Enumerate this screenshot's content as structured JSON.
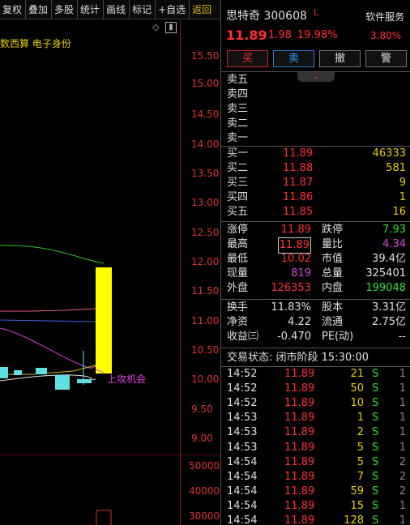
{
  "toolbar": {
    "items": [
      "复权",
      "叠加",
      "多股",
      "统计",
      "画线",
      "标记",
      "+自选",
      "返回"
    ]
  },
  "chart": {
    "indicator_label": "数西算 电子身份",
    "signal_label": "上攻机会",
    "price_ticks": [
      "15.50",
      "15.00",
      "14.50",
      "14.00",
      "13.50",
      "13.00",
      "12.50",
      "12.00",
      "11.50",
      "11.00",
      "10.50",
      "10.00",
      "9.50",
      "9.00"
    ],
    "volume_ticks": [
      "50000",
      "40000",
      "30000"
    ]
  },
  "header": {
    "stock_name": "思特奇",
    "stock_code": "300608",
    "flag": "L",
    "sector": "软件服务",
    "price": "11.89",
    "change": "1.98",
    "change_pct": "19.98%",
    "sector_pct": "3.80%"
  },
  "actions": {
    "buy": "买",
    "sell": "卖",
    "cancel": "撤",
    "alert": "警"
  },
  "asks": [
    {
      "label": "卖五",
      "price": "",
      "vol": ""
    },
    {
      "label": "卖四",
      "price": "",
      "vol": ""
    },
    {
      "label": "卖三",
      "price": "",
      "vol": ""
    },
    {
      "label": "卖二",
      "price": "",
      "vol": ""
    },
    {
      "label": "卖一",
      "price": "",
      "vol": ""
    }
  ],
  "bids": [
    {
      "label": "买一",
      "price": "11.89",
      "vol": "46333"
    },
    {
      "label": "买二",
      "price": "11.88",
      "vol": "581"
    },
    {
      "label": "买三",
      "price": "11.87",
      "vol": "9"
    },
    {
      "label": "买四",
      "price": "11.86",
      "vol": "1"
    },
    {
      "label": "买五",
      "price": "11.85",
      "vol": "16"
    }
  ],
  "stats": {
    "limit_up_label": "涨停",
    "limit_up": "11.89",
    "limit_down_label": "跌停",
    "limit_down": "7.93",
    "high_label": "最高",
    "high": "11.89",
    "vol_ratio_label": "量比",
    "vol_ratio": "4.34",
    "low_label": "最低",
    "low": "10.02",
    "mkt_cap_label": "市值",
    "mkt_cap": "39.4亿",
    "cur_vol_label": "现量",
    "cur_vol": "819",
    "total_vol_label": "总量",
    "total_vol": "325401",
    "outer_label": "外盘",
    "outer": "126353",
    "inner_label": "内盘",
    "inner": "199048",
    "turnover_label": "换手",
    "turnover": "11.83%",
    "shares_label": "股本",
    "shares": "3.31亿",
    "nav_label": "净资",
    "nav": "4.22",
    "float_label": "流通",
    "float": "2.75亿",
    "eps_label": "收益㈢",
    "eps": "-0.470",
    "pe_label": "PE(动)",
    "pe": "--"
  },
  "trade_status": "交易状态: 闭市阶段 15:30:00",
  "ticks": [
    {
      "time": "14:52",
      "price": "11.89",
      "vol": "21",
      "side": "S",
      "cnt": "1"
    },
    {
      "time": "14:52",
      "price": "11.89",
      "vol": "50",
      "side": "S",
      "cnt": "1"
    },
    {
      "time": "14:52",
      "price": "11.89",
      "vol": "10",
      "side": "S",
      "cnt": "1"
    },
    {
      "time": "14:53",
      "price": "11.89",
      "vol": "1",
      "side": "S",
      "cnt": "1"
    },
    {
      "time": "14:53",
      "price": "11.89",
      "vol": "2",
      "side": "S",
      "cnt": "1"
    },
    {
      "time": "14:53",
      "price": "11.89",
      "vol": "5",
      "side": "S",
      "cnt": "1"
    },
    {
      "time": "14:54",
      "price": "11.89",
      "vol": "5",
      "side": "S",
      "cnt": "2"
    },
    {
      "time": "14:54",
      "price": "11.89",
      "vol": "7",
      "side": "S",
      "cnt": "2"
    },
    {
      "time": "14:54",
      "price": "11.89",
      "vol": "59",
      "side": "S",
      "cnt": "2"
    },
    {
      "time": "14:54",
      "price": "11.89",
      "vol": "15",
      "side": "S",
      "cnt": "1"
    },
    {
      "time": "14:54",
      "price": "11.89",
      "vol": "128",
      "side": "S",
      "cnt": "1"
    }
  ]
}
